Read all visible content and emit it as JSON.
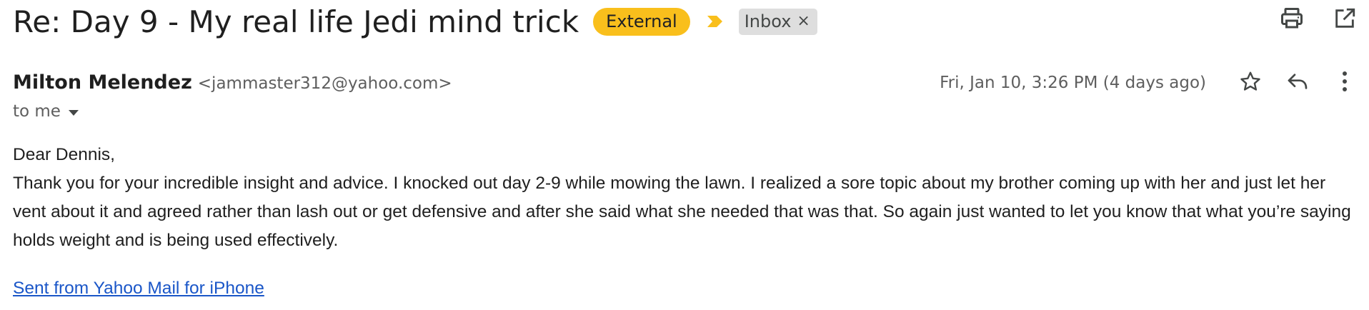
{
  "email": {
    "subject": "Re: Day 9 - My real life Jedi mind trick",
    "labels": {
      "external": "External",
      "inbox": "Inbox",
      "remove_symbol": "×"
    },
    "sender": {
      "name": "Milton Melendez",
      "email": "<jammaster312@yahoo.com>"
    },
    "recipient": "to me",
    "date": "Fri, Jan 10, 3:26 PM (4 days ago)",
    "body": {
      "greeting": "Dear Dennis,",
      "text": "Thank you for your incredible insight and advice. I knocked out day 2-9 while mowing the lawn. I realized a sore topic about my brother coming up with her and just let her vent about it and agreed rather than lash out or get defensive and after she said what she needed that was that. So again just wanted to let you know that what you’re saying holds weight and is being used effectively."
    },
    "signature_link": "Sent from Yahoo Mail for iPhone"
  },
  "icons": {
    "importance": "importance-marker-icon",
    "print": "print-icon",
    "open_new_window": "open-in-new-window-icon",
    "star": "star-icon",
    "reply": "reply-icon",
    "more": "more-vertical-icon",
    "dropdown": "caret-down-icon"
  },
  "colors": {
    "external_label": "#f9bf1c",
    "importance_marker": "#f9bf1c",
    "inbox_label": "#dedede",
    "link": "#1a56c8"
  }
}
